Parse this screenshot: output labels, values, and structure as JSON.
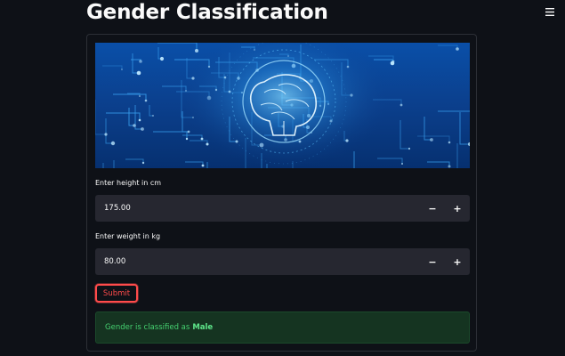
{
  "app": {
    "title": "Gender Classification",
    "menu_icon": "hamburger-menu-icon"
  },
  "banner": {
    "description_icon": "ai-brain-circuit-image"
  },
  "height_field": {
    "label": "Enter height in cm",
    "value": "175.00",
    "decrement_label": "−",
    "increment_label": "+"
  },
  "weight_field": {
    "label": "Enter weight in kg",
    "value": "80.00",
    "decrement_label": "−",
    "increment_label": "+"
  },
  "submit": {
    "label": "Submit"
  },
  "result": {
    "prefix": "Gender is classified as",
    "value": "Male"
  },
  "colors": {
    "background": "#0e1117",
    "input_background": "#262730",
    "accent": "#ff4b4b",
    "success_text": "#45d170",
    "success_background": "#153421"
  }
}
